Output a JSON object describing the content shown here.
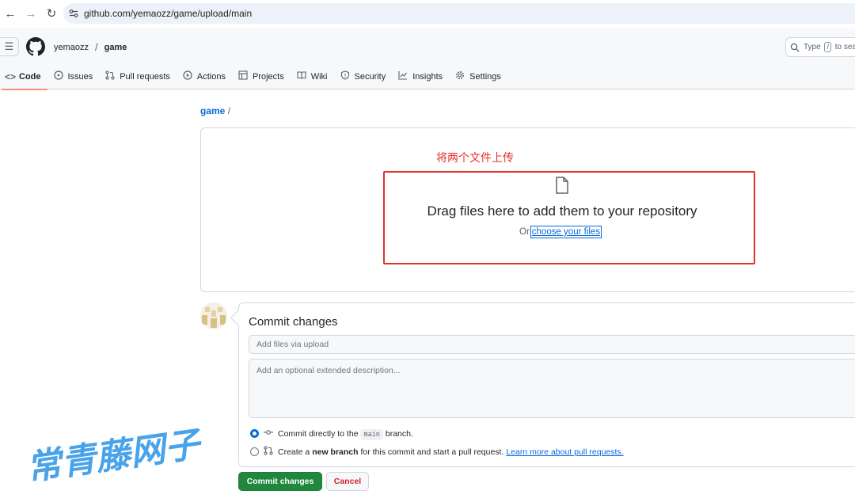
{
  "browser": {
    "url": "github.com/yemaozz/game/upload/main"
  },
  "header": {
    "owner": "yemaozz",
    "separator": "/",
    "repo": "game",
    "search_placeholder_prefix": "Type",
    "search_key": "/",
    "search_placeholder_suffix": "to sea"
  },
  "tabs": [
    {
      "label": "Code",
      "icon": "code-icon"
    },
    {
      "label": "Issues",
      "icon": "issue-opened-icon"
    },
    {
      "label": "Pull requests",
      "icon": "git-pull-request-icon"
    },
    {
      "label": "Actions",
      "icon": "play-icon"
    },
    {
      "label": "Projects",
      "icon": "table-icon"
    },
    {
      "label": "Wiki",
      "icon": "book-icon"
    },
    {
      "label": "Security",
      "icon": "shield-icon"
    },
    {
      "label": "Insights",
      "icon": "graph-icon"
    },
    {
      "label": "Settings",
      "icon": "gear-icon"
    }
  ],
  "path": {
    "repo": "game",
    "slash": "/"
  },
  "upload": {
    "annotation": "将两个文件上传",
    "title": "Drag files here to add them to your repository",
    "or": "Or",
    "choose_link": "choose your files"
  },
  "commit": {
    "title": "Commit changes",
    "summary_placeholder": "Add files via upload",
    "description_placeholder": "Add an optional extended description...",
    "option_direct_prefix": "Commit directly to the",
    "option_direct_branch": "main",
    "option_direct_suffix": "branch.",
    "option_new_prefix": "Create a",
    "option_new_bold": "new branch",
    "option_new_suffix": "for this commit and start a pull request.",
    "option_new_link": "Learn more about pull requests.",
    "commit_button": "Commit changes",
    "cancel_button": "Cancel"
  },
  "watermark": {
    "text": "常青藤网子"
  },
  "colors": {
    "accent": "#0969da",
    "commit_green": "#1f883d",
    "annotation_red": "#e2312a",
    "tab_underline": "#fd8c73",
    "watermark_blue": "#4aa3e8"
  }
}
